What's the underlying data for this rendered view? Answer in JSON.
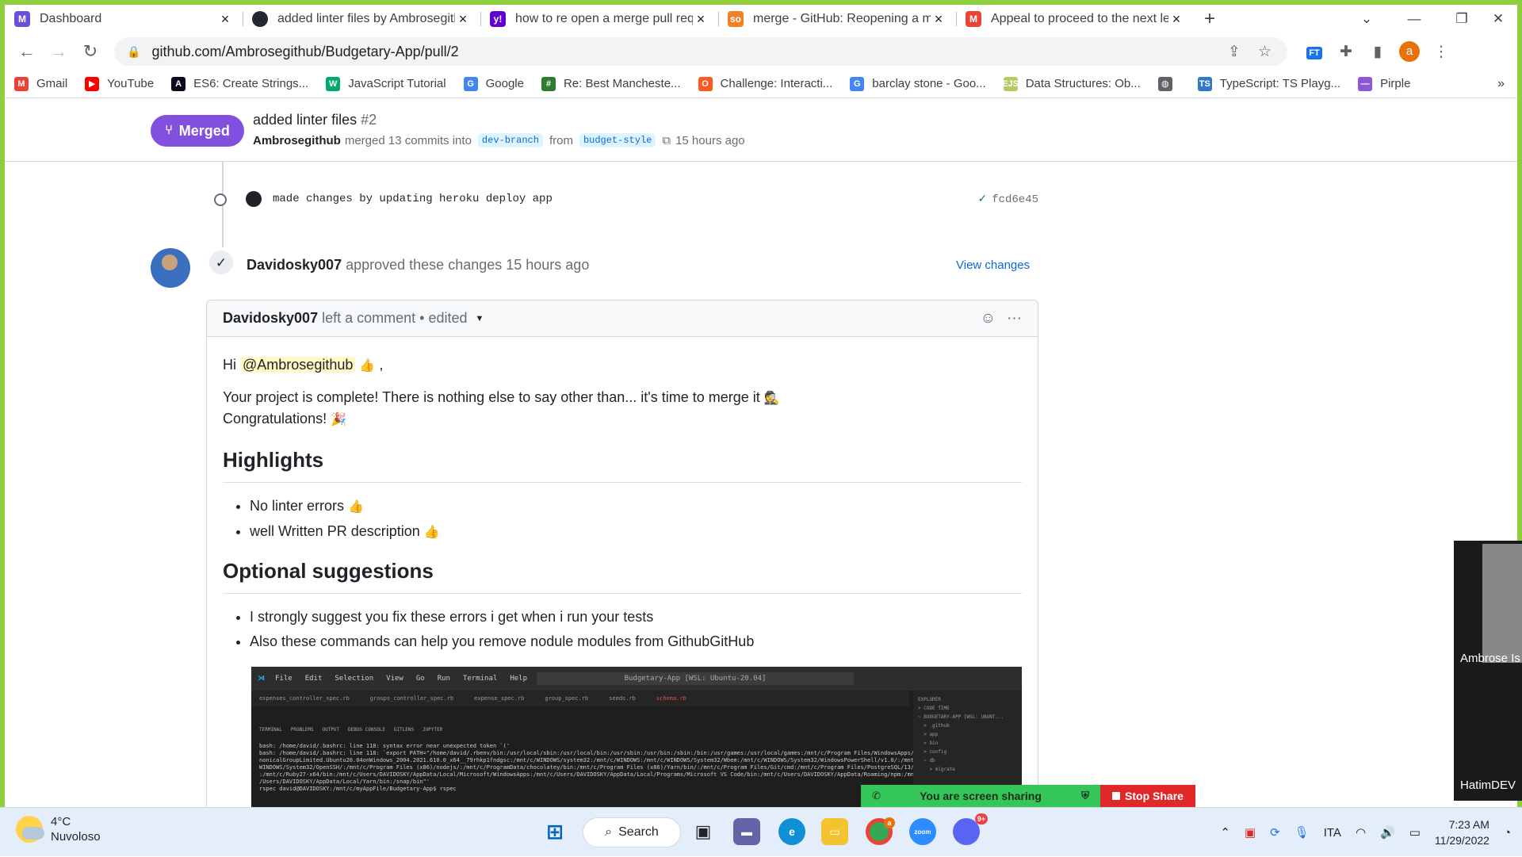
{
  "browser": {
    "tabs": [
      {
        "title": "Dashboard",
        "favicon": "M",
        "fav_color": "#6b4fd8"
      },
      {
        "title": "added linter files by Ambrosegith",
        "favicon": "gh",
        "fav_color": "#24292f"
      },
      {
        "title": "how to re open a merge pull requ",
        "favicon": "y!",
        "fav_color": "#6001d2"
      },
      {
        "title": "merge - GitHub: Reopening a me",
        "favicon": "so",
        "fav_color": "#f48024"
      },
      {
        "title": "Appeal to proceed to the next le",
        "favicon": "M",
        "fav_color": "#ea4335"
      }
    ],
    "new_tab": "+",
    "url": "github.com/Ambrosegithub/Budgetary-App/pull/2",
    "profile_initial": "a",
    "extension_label": "FT"
  },
  "bookmarks": [
    {
      "label": "Gmail",
      "icon": "gmail-icon",
      "color": "#ea4335",
      "glyph": "M"
    },
    {
      "label": "YouTube",
      "icon": "youtube-icon",
      "color": "#ff0000",
      "glyph": "▶"
    },
    {
      "label": "ES6: Create Strings...",
      "icon": "freecodecamp-icon",
      "color": "#0a0a23",
      "glyph": "A"
    },
    {
      "label": "JavaScript Tutorial",
      "icon": "w3schools-icon",
      "color": "#04aa6d",
      "glyph": "W"
    },
    {
      "label": "Google",
      "icon": "google-icon",
      "color": "#4285f4",
      "glyph": "G"
    },
    {
      "label": "Re: Best Mancheste...",
      "icon": "forum-icon",
      "color": "#2e7d32",
      "glyph": "#"
    },
    {
      "label": "Challenge: Interacti...",
      "icon": "challenge-icon",
      "color": "#ff5722",
      "glyph": "O"
    },
    {
      "label": "barclay stone - Goo...",
      "icon": "google-icon",
      "color": "#4285f4",
      "glyph": "G"
    },
    {
      "label": "Data Structures: Ob...",
      "icon": "ejs-icon",
      "color": "#b4ca65",
      "glyph": "EJS"
    },
    {
      "label": "",
      "icon": "globe-icon",
      "color": "#5f6368",
      "glyph": "◍"
    },
    {
      "label": "TypeScript: TS Playg...",
      "icon": "typescript-icon",
      "color": "#3178c6",
      "glyph": "TS"
    },
    {
      "label": "Pirple",
      "icon": "pirple-icon",
      "color": "#8e57d6",
      "glyph": "—"
    }
  ],
  "bookmarks_more": "»",
  "pr": {
    "status": "Merged",
    "title": "added linter files",
    "number": "#2",
    "author": "Ambrosegithub",
    "merged_text": "merged 13 commits into",
    "base_branch": "dev-branch",
    "from_text": "from",
    "head_branch": "budget-style",
    "time": "15 hours ago"
  },
  "commit": {
    "message": "made changes by updating heroku deploy app",
    "sha": "fcd6e45"
  },
  "review": {
    "user": "Davidosky007",
    "text": "approved these changes 15 hours ago",
    "view_changes": "View changes"
  },
  "comment": {
    "user": "Davidosky007",
    "action": "left a comment",
    "edited": "• edited",
    "greeting": "Hi",
    "mention": "@Ambrosegithub",
    "greeting_tail": ",",
    "line1": "Your project is complete! There is nothing else to say other than... it's time to merge it",
    "line2": "Congratulations!",
    "h_highlights": "Highlights",
    "highlights": [
      "No linter errors",
      "well Written PR description"
    ],
    "h_suggestions": "Optional suggestions",
    "suggestions": [
      "I strongly suggest you fix these errors i get when i run your tests",
      "Also these commands can help you remove nodule modules from GithubGitHub"
    ]
  },
  "vscode": {
    "menu": [
      "File",
      "Edit",
      "Selection",
      "View",
      "Go",
      "Run",
      "Terminal",
      "Help"
    ],
    "search": "Budgetary-App [WSL: Ubuntu-20.04]",
    "tabs": [
      "expenses_controller_spec.rb",
      "groups_controller_spec.rb",
      "expense_spec.rb",
      "group_spec.rb",
      "seeds.rb",
      "schema.rb"
    ],
    "panel_tabs": "TERMINAL   PROBLEMS   OUTPUT   DEBUG CONSOLE   GITLENS   JUPYTER",
    "terminal": "bash: /home/david/.bashrc: line 118: syntax error near unexpected token `('\nbash: /home/david/.bashrc: line 118: `export PATH=\"/home/david/.rbenv/bin:/usr/local/sbin:/usr/local/bin:/usr/sbin:/usr/bin:/sbin:/bin:/usr/games:/usr/local/games:/mnt/c/Program Files/WindowsApps/Ca\nnonicalGroupLimited.Ubuntu20.04onWindows_2004.2021.610.0_x64__79rhkp1fndgsc:/mnt/c/WINDOWS/system32:/mnt/c/WINDOWS:/mnt/c/WINDOWS/System32/Wbem:/mnt/c/WINDOWS/System32/WindowsPowerShell/v1.0/:/mnt/c/\nWINDOWS/System32/OpenSSH/:/mnt/c/Program Files (x86)/nodejs/:/mnt/c/ProgramData/chocolatey/bin:/mnt/c/Program Files (x86)/Yarn/bin/:/mnt/c/Program Files/Git/cmd:/mnt/c/Program Files/PostgreSQL/13/bin\n:/mnt/c/Ruby27-x64/bin:/mnt/c/Users/DAVIDOSKY/AppData/Local/Microsoft/WindowsApps:/mnt/c/Users/DAVIDOSKY/AppData/Local/Programs/Microsoft VS Code/bin:/mnt/c/Users/DAVIDOSKY/AppData/Roaming/npm:/mnt/c\n/Users/DAVIDOSKY/AppData/Local/Yarn/bin:/snap/bin\"'\nrspec david@DAVIDOSKY:/mnt/c/myAppFile/Budgetary-App$ rspec",
    "explorer": "EXPLORER\n> CODE TIME\n~ BUDGETARY-APP [WSL: UBUNT...\n  > .github\n  > app\n  > bin\n  > config\n  ~ db\n    > migrate"
  },
  "zoom": {
    "sharing": "You are screen sharing",
    "stop": "Stop Share",
    "participant1": "Ambrose Is",
    "participant2": "HatimDEV"
  },
  "taskbar": {
    "temp": "4°C",
    "weather": "Nuvoloso",
    "search": "Search",
    "lang": "ITA",
    "time": "7:23 AM",
    "date": "11/29/2022",
    "chrome_badge": "a",
    "discord_badge": "9+"
  }
}
